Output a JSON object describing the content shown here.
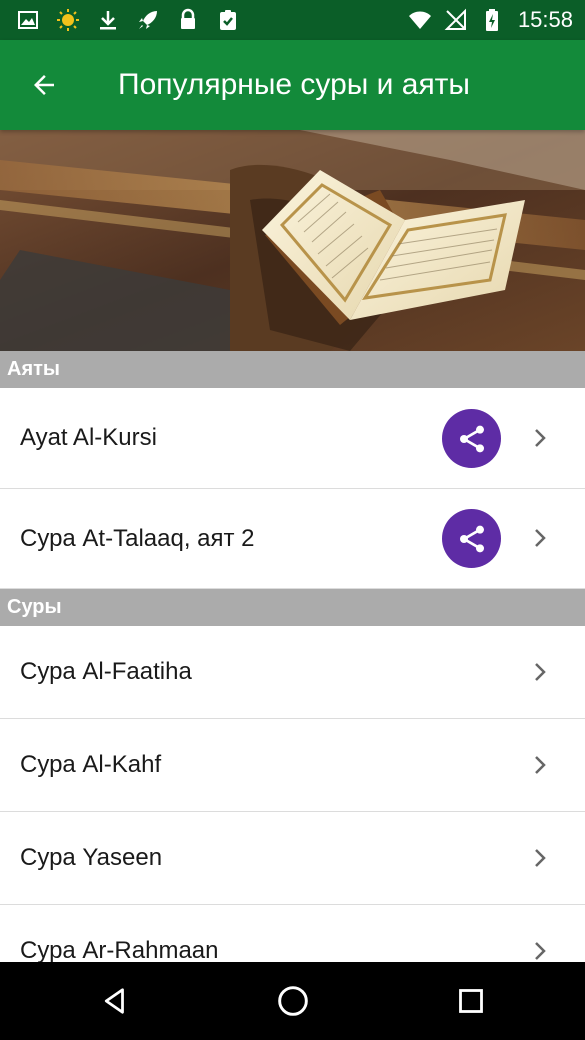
{
  "status_bar": {
    "time": "15:58",
    "left_icons": [
      "image-icon",
      "sun-icon",
      "download-icon",
      "rocket-icon",
      "lock-icon",
      "clipboard-check-icon"
    ],
    "right_icons": [
      "wifi-icon",
      "no-signal-icon",
      "battery-charging-icon"
    ]
  },
  "app_bar": {
    "title": "Популярные суры и аяты",
    "background": "#138a3a",
    "status_background": "#0b5e28"
  },
  "sections": {
    "ayats": {
      "title": "Аяты",
      "items": [
        {
          "label": "Ayat Al-Kursi",
          "has_share": true
        },
        {
          "label": "Сура At-Talaaq, аят 2",
          "has_share": true
        }
      ]
    },
    "surahs": {
      "title": "Суры",
      "items": [
        {
          "label": "Сура Al-Faatiha",
          "has_share": false
        },
        {
          "label": "Сура Al-Kahf",
          "has_share": false
        },
        {
          "label": "Сура Yaseen",
          "has_share": false
        },
        {
          "label": "Сура Ar-Rahmaan",
          "has_share": false
        }
      ]
    }
  },
  "colors": {
    "share_button": "#5e2ca5",
    "section_header": "#ababab"
  },
  "nav_bar": {
    "buttons": [
      "back-triangle-icon",
      "home-circle-icon",
      "recents-square-icon"
    ]
  }
}
